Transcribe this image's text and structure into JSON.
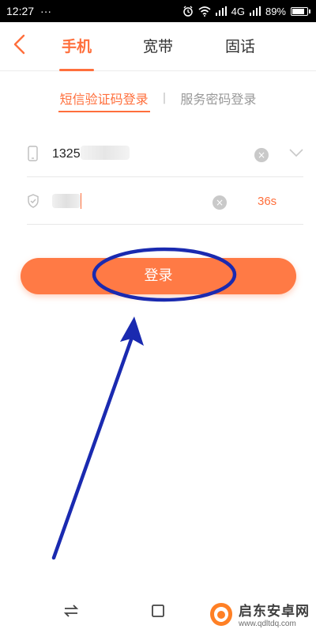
{
  "status_bar": {
    "time": "12:27",
    "more": "···",
    "network": "4G",
    "battery": "89%"
  },
  "header": {
    "tabs": [
      {
        "label": "手机",
        "active": true
      },
      {
        "label": "宽带",
        "active": false
      },
      {
        "label": "固话",
        "active": false
      }
    ]
  },
  "login_modes": {
    "sms": "短信验证码登录",
    "password": "服务密码登录",
    "separator": "|"
  },
  "phone_field": {
    "value_prefix": "1325",
    "clear": "×"
  },
  "code_field": {
    "countdown": "36s",
    "clear": "×"
  },
  "login_button": {
    "label": "登录"
  },
  "watermark": {
    "name": "启东安卓网",
    "url": "www.qdltdq.com"
  },
  "colors": {
    "accent": "#ff6f3c",
    "button": "#ff7a45",
    "annotation": "#1a2ab0"
  }
}
